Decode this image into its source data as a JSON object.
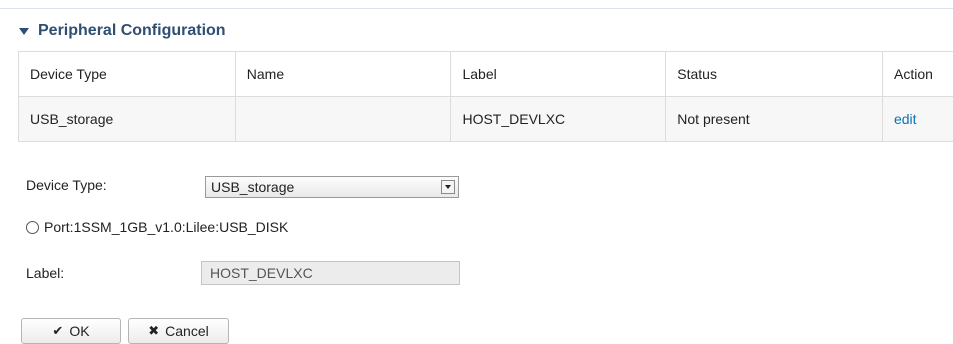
{
  "section": {
    "title": "Peripheral Configuration"
  },
  "table": {
    "headers": [
      "Device Type",
      "Name",
      "Label",
      "Status",
      "Action"
    ],
    "rows": [
      [
        "USB_storage",
        "",
        "HOST_DEVLXC",
        "Not present",
        "edit"
      ]
    ]
  },
  "form": {
    "device_type_label": "Device Type:",
    "device_type_value": "USB_storage",
    "port_option": "Port:1SSM_1GB_v1.0:Lilee:USB_DISK",
    "label_label": "Label:",
    "label_value": "HOST_DEVLXC"
  },
  "buttons": {
    "ok": "OK",
    "cancel": "Cancel"
  },
  "icons": {
    "section_toggle": "triangle-down-icon",
    "select_dropdown": "chevron-down-icon",
    "ok": "check-icon",
    "cancel": "close-icon"
  },
  "colors": {
    "section_title": "#2e4f73",
    "link": "#0b72b5"
  }
}
